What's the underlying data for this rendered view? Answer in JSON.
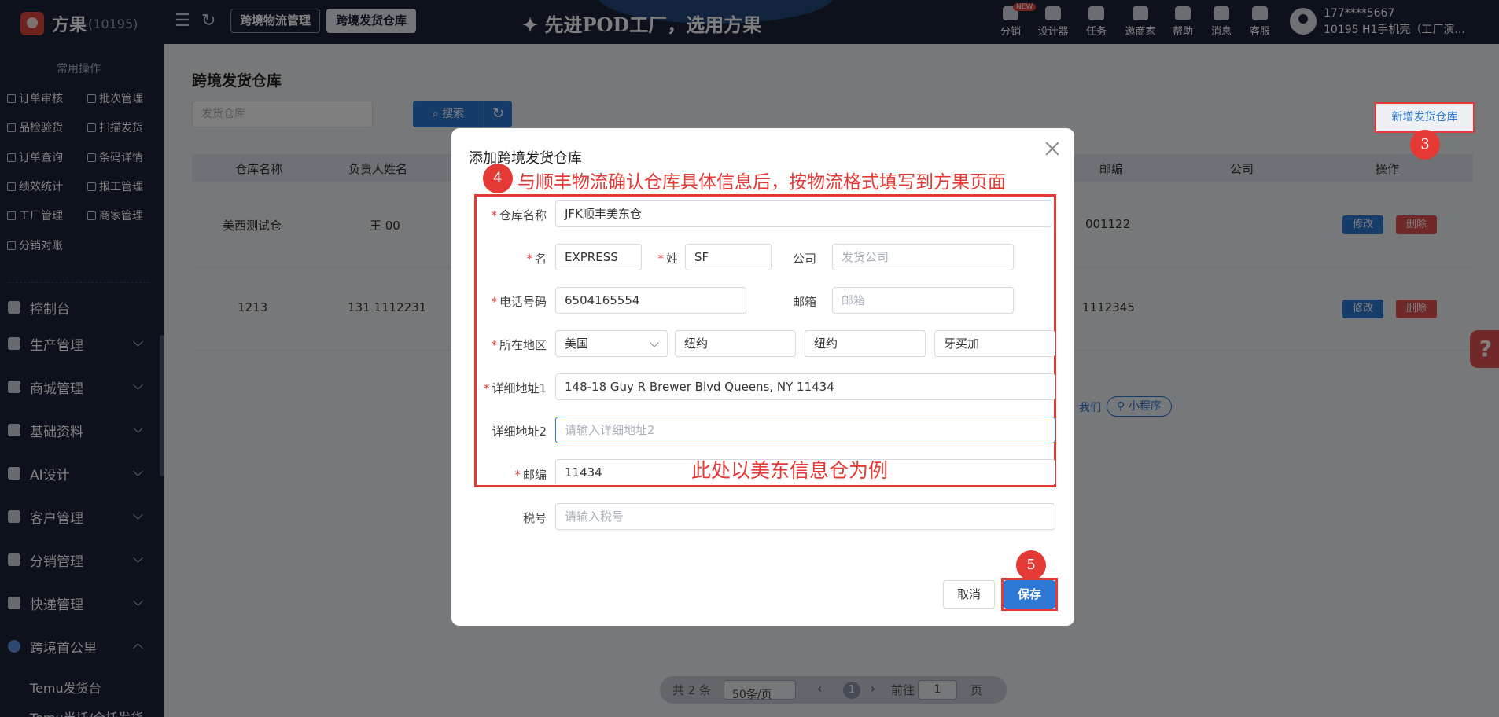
{
  "app": {
    "name": "方果",
    "account_id": "(10195)"
  },
  "header": {
    "tabs": [
      {
        "label": "跨境物流管理"
      },
      {
        "label": "跨境发货仓库"
      }
    ],
    "slogan": "✦ 先进POD工厂，选用方果",
    "tools": [
      {
        "label": "分销",
        "badge": "NEW"
      },
      {
        "label": "设计器"
      },
      {
        "label": "任务"
      },
      {
        "label": "邀商家"
      },
      {
        "label": "帮助"
      },
      {
        "label": "消息"
      },
      {
        "label": "客服"
      }
    ],
    "user": {
      "phone": "177****5667",
      "company": "10195 H1手机壳（工厂演..."
    }
  },
  "sidebar": {
    "quick_title": "常用操作",
    "quick_items": [
      {
        "label": "订单审核"
      },
      {
        "label": "批次管理"
      },
      {
        "label": "品检验货"
      },
      {
        "label": "扫描发货"
      },
      {
        "label": "订单查询"
      },
      {
        "label": "条码详情"
      },
      {
        "label": "绩效统计"
      },
      {
        "label": "报工管理"
      },
      {
        "label": "工厂管理"
      },
      {
        "label": "商家管理"
      },
      {
        "label": "分销对账"
      }
    ],
    "menu": [
      {
        "label": "控制台"
      },
      {
        "label": "生产管理"
      },
      {
        "label": "商城管理"
      },
      {
        "label": "基础资料"
      },
      {
        "label": "AI设计"
      },
      {
        "label": "客户管理"
      },
      {
        "label": "分销管理"
      },
      {
        "label": "快递管理"
      },
      {
        "label": "跨境首公里"
      }
    ],
    "submenu": [
      {
        "label": "Temu发货台"
      },
      {
        "label": "Temu半托/全托发货"
      }
    ]
  },
  "main": {
    "title": "跨境发货仓库",
    "search": {
      "placeholder": "发货仓库",
      "button": "搜索"
    },
    "add_button": "新增发货仓库",
    "table": {
      "headers": [
        "仓库名称",
        "负责人姓名",
        "邮编",
        "公司",
        "操作"
      ],
      "rows": [
        {
          "name": "美西测试仓",
          "contact": "王 00",
          "zip": "001122"
        },
        {
          "name": "1213",
          "contact": "131 1112231",
          "zip": "1112345"
        }
      ],
      "edit_label": "修改",
      "delete_label": "删除"
    },
    "footer_link": "我们",
    "mini_program": "小程序",
    "help_float": "?",
    "pagination": {
      "total": "共 2 条",
      "page_size": "50条/页",
      "current": "1",
      "goto": "前往",
      "goto_value": "1",
      "page_unit": "页"
    }
  },
  "modal": {
    "title": "添加跨境发货仓库",
    "fields": {
      "warehouse_name": {
        "label": "仓库名称",
        "value": "JFK顺丰美东仓"
      },
      "first_name": {
        "label": "名",
        "value": "EXPRESS"
      },
      "last_name": {
        "label": "姓",
        "value": "SF"
      },
      "company": {
        "label": "公司",
        "placeholder": "发货公司"
      },
      "phone": {
        "label": "电话号码",
        "value": "6504165554"
      },
      "email": {
        "label": "邮箱",
        "placeholder": "邮箱"
      },
      "region": {
        "label": "所在地区",
        "country": "美国",
        "state": "纽约",
        "city": "纽约",
        "district": "牙买加"
      },
      "address1": {
        "label": "详细地址1",
        "value": "148-18 Guy R Brewer Blvd Queens, NY 11434"
      },
      "address2": {
        "label": "详细地址2",
        "placeholder": "请输入详细地址2"
      },
      "zip": {
        "label": "邮编",
        "value": "11434"
      },
      "tax": {
        "label": "税号",
        "placeholder": "请输入税号"
      }
    },
    "cancel": "取消",
    "save": "保存"
  },
  "annotations": {
    "step3": "3",
    "step4": "4",
    "step4_text": "与顺丰物流确认仓库具体信息后，按物流格式填写到方果页面",
    "step5": "5",
    "example_text": "此处以美东信息仓为例"
  },
  "colors": {
    "primary": "#2d78d4",
    "danger": "#e05150",
    "annotation": "#e53935",
    "nav_bg": "#1b2338"
  }
}
